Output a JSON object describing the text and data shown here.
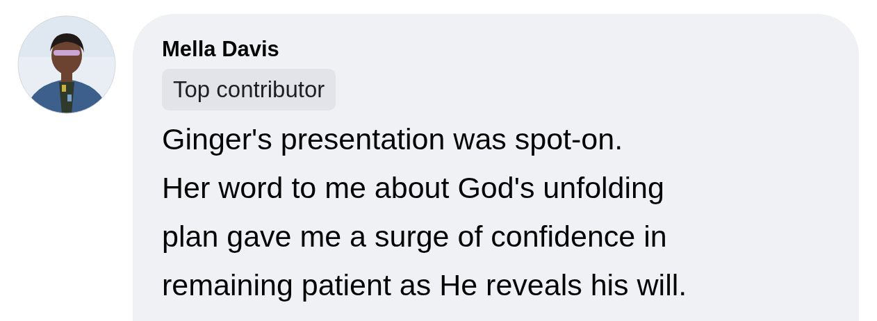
{
  "comment": {
    "author": "Mella Davis",
    "badge": "Top contributor",
    "text": "Ginger's presentation was spot-on.\nHer word to me about God's unfolding\nplan gave me a surge of confidence in\nremaining patient as He reveals his will."
  }
}
